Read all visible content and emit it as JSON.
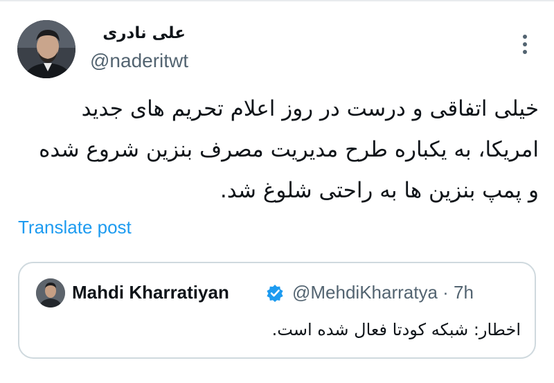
{
  "author": {
    "display_name": "علی نادری",
    "handle": "@naderitwt"
  },
  "tweet": {
    "lines": [
      "خیلی اتفاقی و درست در روز اعلام تحریم های جدید",
      "امریکا، به یکباره طرح مدیریت مصرف بنزین شروع شده",
      "و پمپ بنزین ها به راحتی شلوغ شد."
    ],
    "translate_label": "Translate post"
  },
  "quoted": {
    "display_name": "Mahdi Kharratiyan",
    "handle_time": "@MehdiKharratya · 7h",
    "text": "اخطار: شبکه کودتا فعال شده است."
  },
  "icons": {
    "more": "more-vertical-icon",
    "verified": "verified-badge-icon"
  },
  "colors": {
    "accent": "#1d9bf0",
    "secondary_text": "#536471",
    "border": "#cfd9de"
  }
}
